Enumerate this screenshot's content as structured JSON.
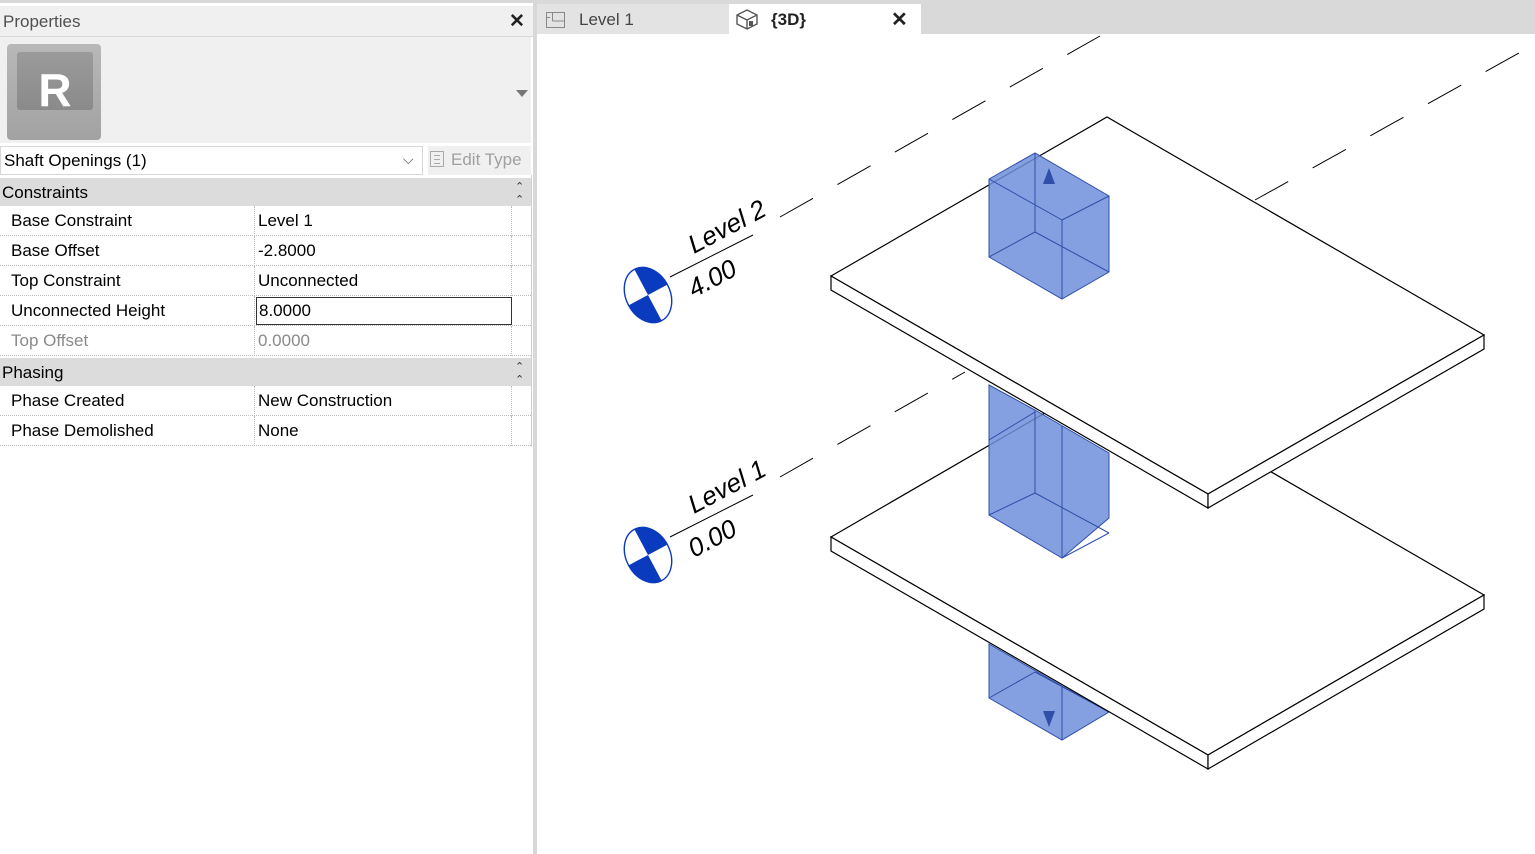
{
  "properties": {
    "title": "Properties",
    "type_name": "Shaft Openings (1)",
    "edit_type_label": "Edit Type",
    "logo_letter": "R",
    "groups": {
      "constraints": {
        "title": "Constraints",
        "rows": [
          {
            "name": "Base Constraint",
            "value": "Level 1"
          },
          {
            "name": "Base Offset",
            "value": "-2.8000"
          },
          {
            "name": "Top Constraint",
            "value": "Unconnected"
          },
          {
            "name": "Unconnected Height",
            "value": "8.0000"
          },
          {
            "name": "Top Offset",
            "value": "0.0000"
          }
        ]
      },
      "phasing": {
        "title": "Phasing",
        "rows": [
          {
            "name": "Phase Created",
            "value": "New Construction"
          },
          {
            "name": "Phase Demolished",
            "value": "None"
          }
        ]
      }
    }
  },
  "tabs": [
    {
      "label": "Level 1",
      "active": false
    },
    {
      "label": "{3D}",
      "active": true
    }
  ],
  "view": {
    "levels": [
      {
        "name": "Level 2",
        "elevation": "4.00"
      },
      {
        "name": "Level 1",
        "elevation": "0.00"
      }
    ],
    "colors": {
      "shaft_fill": "#6f8fdc",
      "level_marker": "#0a3bbf",
      "panel_gray": "#f0f0f0",
      "group_header": "#dcdcdc"
    }
  }
}
